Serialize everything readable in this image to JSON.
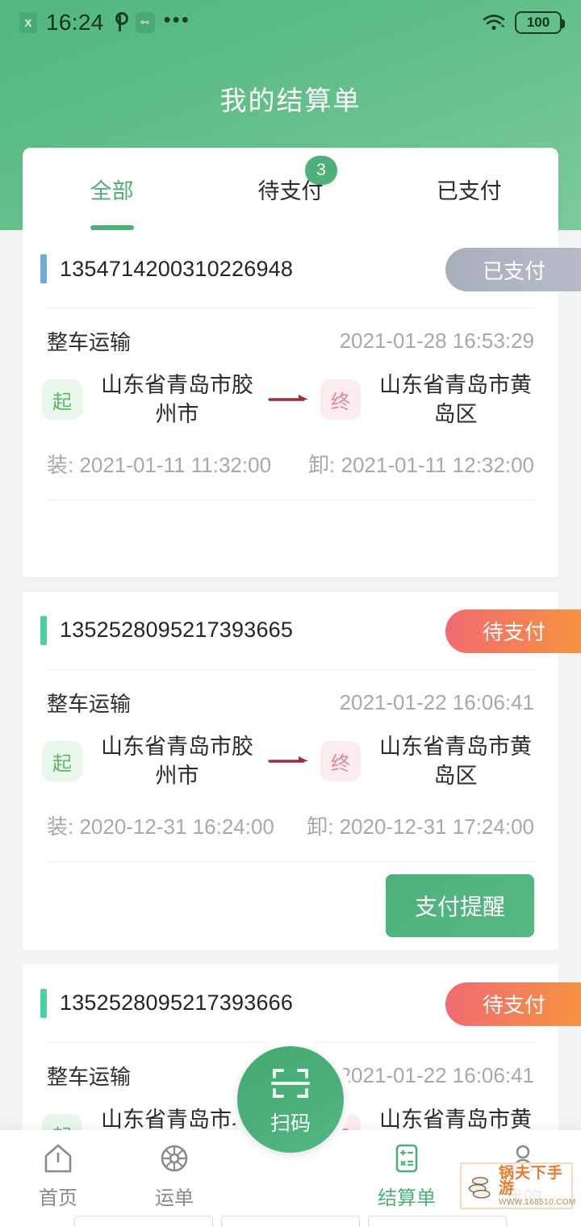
{
  "statusbar": {
    "sim_label": "X",
    "time": "16:24",
    "usb_icon": "usb-icon",
    "adb_icon": "adb-icon",
    "more_icon": "more-dots-icon",
    "wifi_icon": "wifi-icon",
    "battery_level": "100"
  },
  "header": {
    "title": "我的结算单"
  },
  "tabs": [
    {
      "label": "全部",
      "active": true,
      "badge": ""
    },
    {
      "label": "待支付",
      "active": false,
      "badge": "3"
    },
    {
      "label": "已支付",
      "active": false,
      "badge": ""
    }
  ],
  "labels": {
    "load_prefix": "装:",
    "unload_prefix": "卸:",
    "start_pin": "起",
    "end_pin": "终"
  },
  "colors": {
    "brand_green": "#4cae78",
    "accent_blue": "#6ea8dd",
    "accent_green": "#4ecf9e",
    "badge_paid": "#aeb3c0",
    "badge_pending_from": "#f16a72",
    "badge_pending_to": "#f69340"
  },
  "cards": [
    {
      "order_no": "1354714200310226948",
      "accent": "blue",
      "status": "已支付",
      "status_type": "paid",
      "transport_type": "整车运输",
      "created_at": "2021-01-28 16:53:29",
      "origin": "山东省青岛市胶州市",
      "destination": "山东省青岛市黄岛区",
      "load_time": "2021-01-11 11:32:00",
      "unload_time": "2021-01-11 12:32:00",
      "action_label": ""
    },
    {
      "order_no": "1352528095217393665",
      "accent": "green",
      "status": "待支付",
      "status_type": "pending",
      "transport_type": "整车运输",
      "created_at": "2021-01-22 16:06:41",
      "origin": "山东省青岛市胶州市",
      "destination": "山东省青岛市黄岛区",
      "load_time": "2020-12-31 16:24:00",
      "unload_time": "2020-12-31 17:24:00",
      "action_label": "支付提醒"
    },
    {
      "order_no": "1352528095217393666",
      "accent": "green",
      "status": "待支付",
      "status_type": "pending",
      "transport_type": "整车运输",
      "created_at": "2021-01-22 16:06:41",
      "origin": "山东省青岛市城阳区",
      "destination": "山东省青岛市黄岛区",
      "load_time": "",
      "unload_time": "",
      "action_label": ""
    }
  ],
  "fab": {
    "label": "扫码",
    "icon": "scan-code-icon"
  },
  "bottom_nav": [
    {
      "label": "首页",
      "icon": "home-icon",
      "active": false
    },
    {
      "label": "运单",
      "icon": "wheel-icon",
      "active": false
    },
    {
      "label": "结算单",
      "icon": "calculator-icon",
      "active": true
    },
    {
      "label": "我的",
      "icon": "person-icon",
      "active": false
    }
  ],
  "watermark": {
    "main": "锅夫下手游",
    "sub": "WWW.168510.COM"
  }
}
